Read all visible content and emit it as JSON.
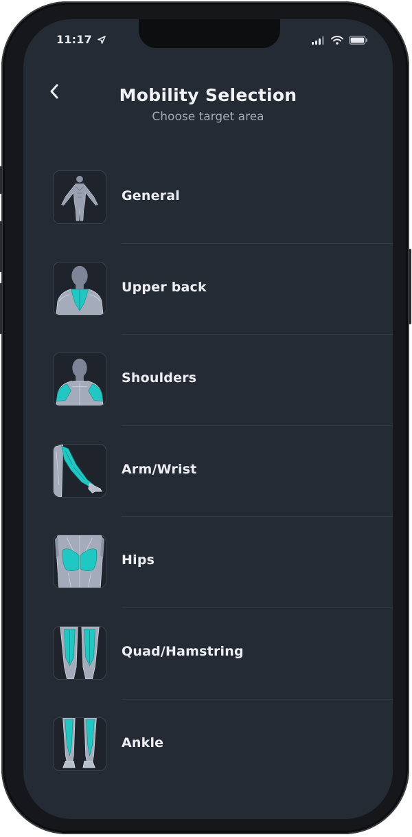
{
  "status_bar": {
    "time": "11:17",
    "location_icon": "location-arrow-icon",
    "signal_icon": "cellular-signal-icon",
    "wifi_icon": "wifi-icon",
    "battery_icon": "battery-icon"
  },
  "header": {
    "back_icon": "chevron-left-icon",
    "title": "Mobility Selection",
    "subtitle": "Choose target area"
  },
  "colors": {
    "background": "#252b35",
    "accent": "#1fc8c2",
    "text": "#eceef2",
    "subtext": "#a2a9b4"
  },
  "areas": [
    {
      "label": "General",
      "icon": "full-body-icon"
    },
    {
      "label": "Upper back",
      "icon": "upper-back-icon"
    },
    {
      "label": "Shoulders",
      "icon": "shoulders-icon"
    },
    {
      "label": "Arm/Wrist",
      "icon": "arm-wrist-icon"
    },
    {
      "label": "Hips",
      "icon": "hips-icon"
    },
    {
      "label": "Quad/Hamstring",
      "icon": "quad-hamstring-icon"
    },
    {
      "label": "Ankle",
      "icon": "ankle-icon"
    }
  ]
}
